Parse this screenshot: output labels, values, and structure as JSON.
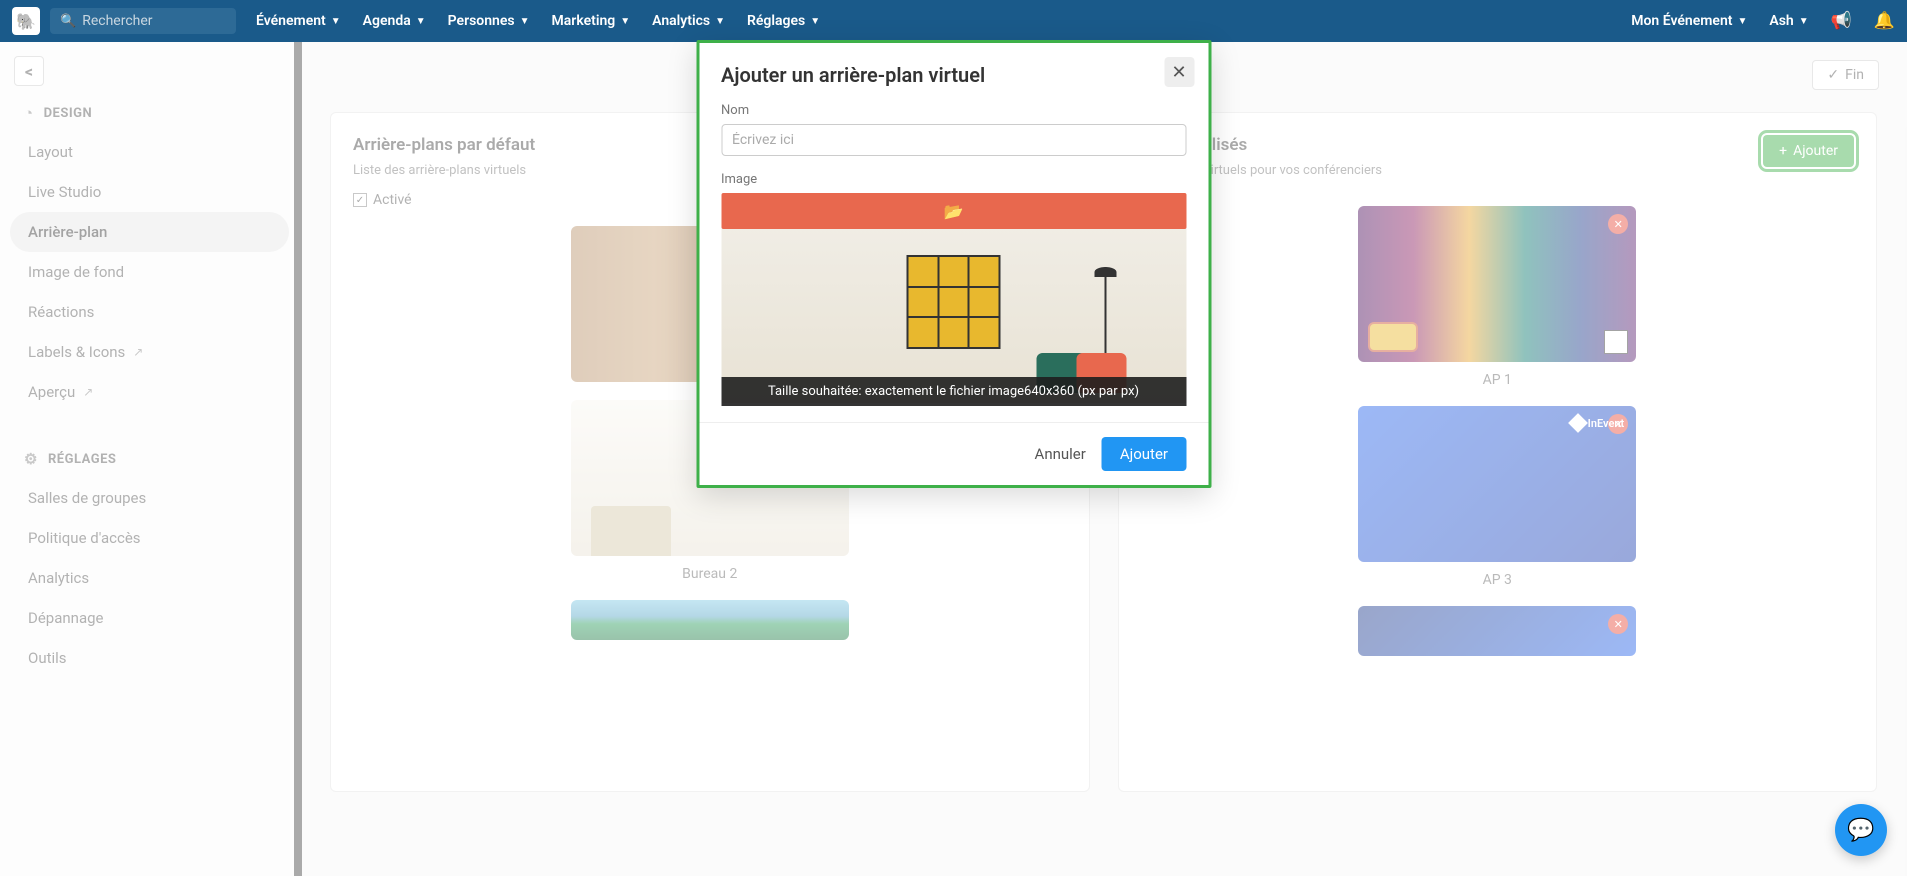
{
  "topbar": {
    "search_placeholder": "Rechercher",
    "menu": [
      "Événement",
      "Agenda",
      "Personnes",
      "Marketing",
      "Analytics",
      "Réglages"
    ],
    "right": {
      "event": "Mon Événement",
      "user": "Ash"
    }
  },
  "sidebar": {
    "sections": [
      {
        "title": "DESIGN",
        "icon": "palette",
        "items": [
          {
            "label": "Layout"
          },
          {
            "label": "Live Studio"
          },
          {
            "label": "Arrière-plan",
            "active": true
          },
          {
            "label": "Image de fond"
          },
          {
            "label": "Réactions"
          },
          {
            "label": "Labels & Icons",
            "external": true
          },
          {
            "label": "Aperçu",
            "external": true
          }
        ]
      },
      {
        "title": "RÉGLAGES",
        "icon": "gear",
        "items": [
          {
            "label": "Salles de groupes"
          },
          {
            "label": "Politique d'accès"
          },
          {
            "label": "Analytics"
          },
          {
            "label": "Dépannage"
          },
          {
            "label": "Outils"
          }
        ]
      }
    ]
  },
  "content": {
    "end_button": "Fin",
    "default_panel": {
      "title": "Arrière-plans par défaut",
      "desc": "Liste des arrière-plans virtuels",
      "enabled_label": "Activé",
      "cards": [
        {
          "label": ""
        },
        {
          "label": "Bureau 2"
        },
        {
          "label": ""
        }
      ]
    },
    "custom_panel": {
      "title_suffix": "personnalisés",
      "desc_suffix": "rière-plans virtuels pour vos conférenciers",
      "add_button": "Ajouter",
      "cards": [
        {
          "label": "AP 1"
        },
        {
          "label": "AP 3"
        },
        {
          "label": ""
        }
      ]
    }
  },
  "modal": {
    "title": "Ajouter un arrière-plan virtuel",
    "name_label": "Nom",
    "name_placeholder": "Écrivez ici",
    "image_label": "Image",
    "size_note": "Taille souhaitée: exactement le fichier image640x360 (px par px)",
    "cancel": "Annuler",
    "submit": "Ajouter"
  },
  "brand": {
    "logo_text": "InEvent"
  }
}
